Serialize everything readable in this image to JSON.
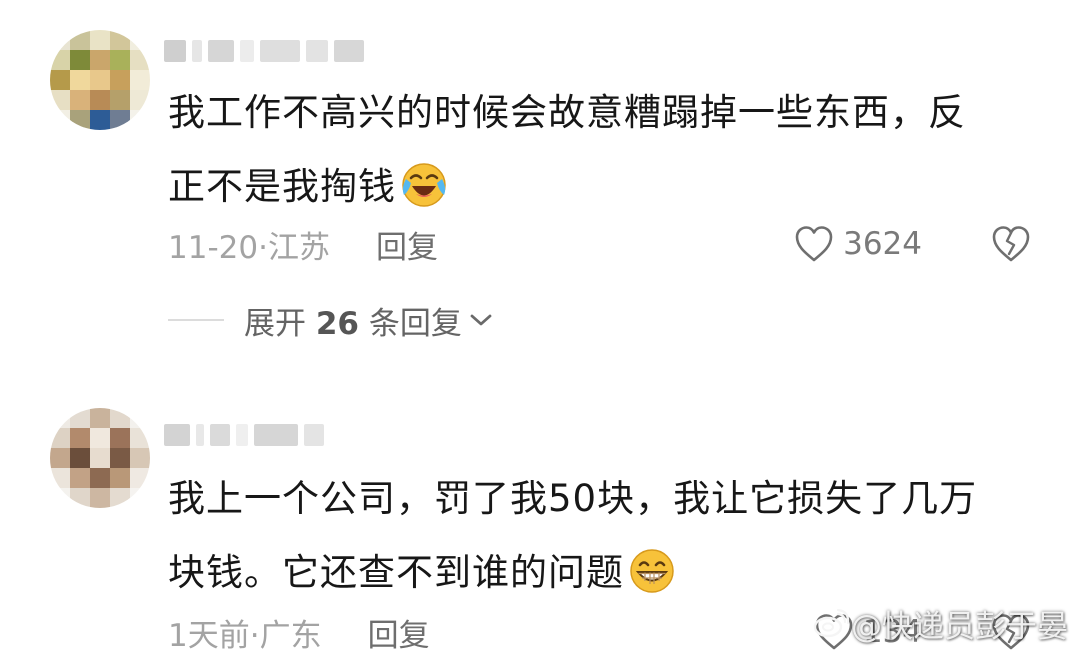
{
  "comments": [
    {
      "text_line1": "我工作不高兴的时候会故意糟蹋掉一些东西，反",
      "text_line2": "正不是我掏钱",
      "emoji": "laughing-crying-emoji",
      "time": "11-20",
      "location": "江苏",
      "reply_label": "回复",
      "like_count": "3624",
      "expand": {
        "prefix": "展开 ",
        "count": "26",
        "suffix": " 条回复"
      }
    },
    {
      "text_line1": "我上一个公司，罚了我50块，我让它损失了几万",
      "text_line2": "块钱。它还查不到谁的问题",
      "emoji": "grinning-emoji",
      "time": "1天前",
      "location": "广东",
      "reply_label": "回复",
      "like_count": "134"
    }
  ],
  "meta_separator": "·",
  "watermark": "@快递员彭于晏",
  "colors": {
    "text": "#171717",
    "meta": "#a3a3a3",
    "reply": "#6e6e6e",
    "emoji_face": "#f7c23a"
  }
}
